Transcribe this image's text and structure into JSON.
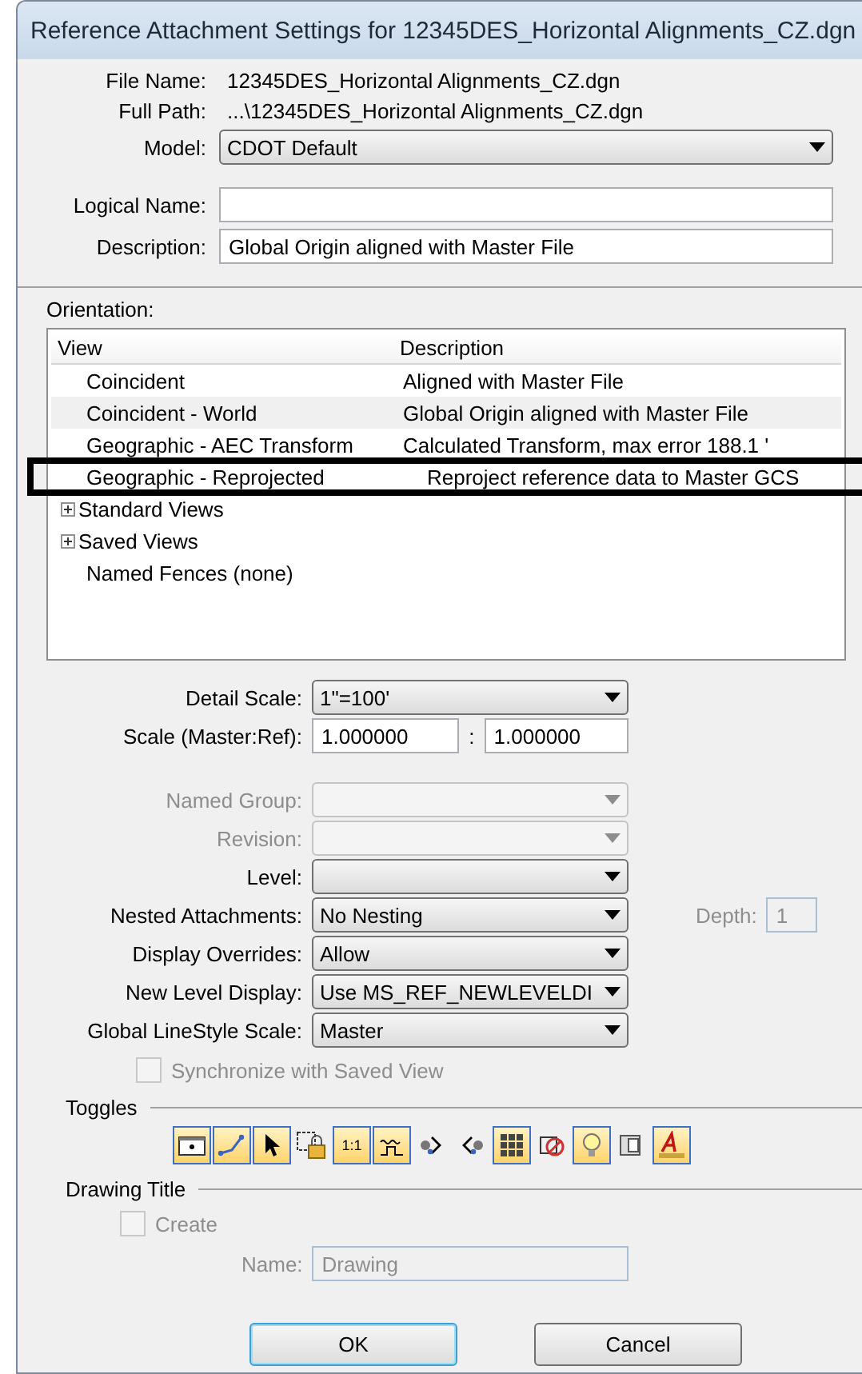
{
  "window": {
    "title": "Reference Attachment Settings for 12345DES_Horizontal Alignments_CZ.dgn"
  },
  "file_info": [
    {
      "label": "File Name:",
      "value": "12345DES_Horizontal Alignments_CZ.dgn"
    },
    {
      "label": "Full Path:",
      "value": "...\\12345DES_Horizontal Alignments_CZ.dgn"
    }
  ],
  "model": {
    "label": "Model:",
    "value": "CDOT Default"
  },
  "logical_name": {
    "label": "Logical Name:"
  },
  "description": {
    "label": "Description:",
    "value": "Global Origin aligned with Master File"
  },
  "orientation": {
    "label": "Orientation:",
    "columns": [
      "View",
      "Description"
    ],
    "rows": [
      {
        "kind": "item",
        "view": "Coincident",
        "description": "Aligned with Master File",
        "selected": false,
        "striped": false
      },
      {
        "kind": "item",
        "view": "Coincident - World",
        "description": "Global Origin aligned with Master File",
        "selected": false,
        "striped": true
      },
      {
        "kind": "item",
        "view": "Geographic - AEC Transform",
        "description": "Calculated Transform, max error 188.1 '",
        "selected": false,
        "striped": false
      },
      {
        "kind": "item",
        "view": "Geographic - Reprojected",
        "description": "Reproject reference data to Master GCS",
        "selected": true,
        "striped": false
      },
      {
        "kind": "group",
        "view": "Standard Views",
        "expanded": false,
        "selected": false,
        "striped": false
      },
      {
        "kind": "group",
        "view": "Saved Views",
        "expanded": false,
        "selected": false,
        "striped": false
      },
      {
        "kind": "item",
        "view": "Named Fences (none)",
        "description": "",
        "selected": false,
        "striped": false
      }
    ]
  },
  "detail_scale": {
    "label": "Detail Scale:",
    "value": "1\"=100'"
  },
  "scale": {
    "label": "Scale (Master:Ref):",
    "master": "1.000000",
    "separator": ":",
    "ref": "1.000000"
  },
  "dropdowns": [
    {
      "label": "Named Group:",
      "disabled": true
    },
    {
      "label": "Revision:",
      "disabled": true
    },
    {
      "label": "Level:",
      "disabled": false
    },
    {
      "label": "Nested Attachments:",
      "value": "No Nesting",
      "disabled": false,
      "depth": {
        "label": "Depth:",
        "value": "1",
        "disabled": true
      }
    },
    {
      "label": "Display Overrides:",
      "value": "Allow",
      "disabled": false
    },
    {
      "label": "New Level Display:",
      "value": "Use MS_REF_NEWLEVELDI",
      "disabled": false
    },
    {
      "label": "Global LineStyle Scale:",
      "value": "Master",
      "disabled": false
    }
  ],
  "synchronize": {
    "label": "Synchronize with Saved View",
    "checked": false,
    "disabled": true
  },
  "toggles": {
    "label": "Toggles",
    "items": [
      {
        "on": true
      },
      {
        "on": true
      },
      {
        "on": true
      },
      {
        "on": false
      },
      {
        "on": true,
        "label": "1:1"
      },
      {
        "on": true
      },
      {
        "on": false
      },
      {
        "on": false
      },
      {
        "on": true
      },
      {
        "on": false
      },
      {
        "on": true
      },
      {
        "on": false
      },
      {
        "on": true
      }
    ]
  },
  "drawing_title": {
    "label": "Drawing Title",
    "create": {
      "label": "Create",
      "checked": false,
      "disabled": true
    },
    "name": {
      "label": "Name:",
      "value": "Drawing",
      "disabled": true
    }
  },
  "buttons": [
    {
      "label": "OK",
      "default": true
    },
    {
      "label": "Cancel",
      "default": false
    }
  ]
}
